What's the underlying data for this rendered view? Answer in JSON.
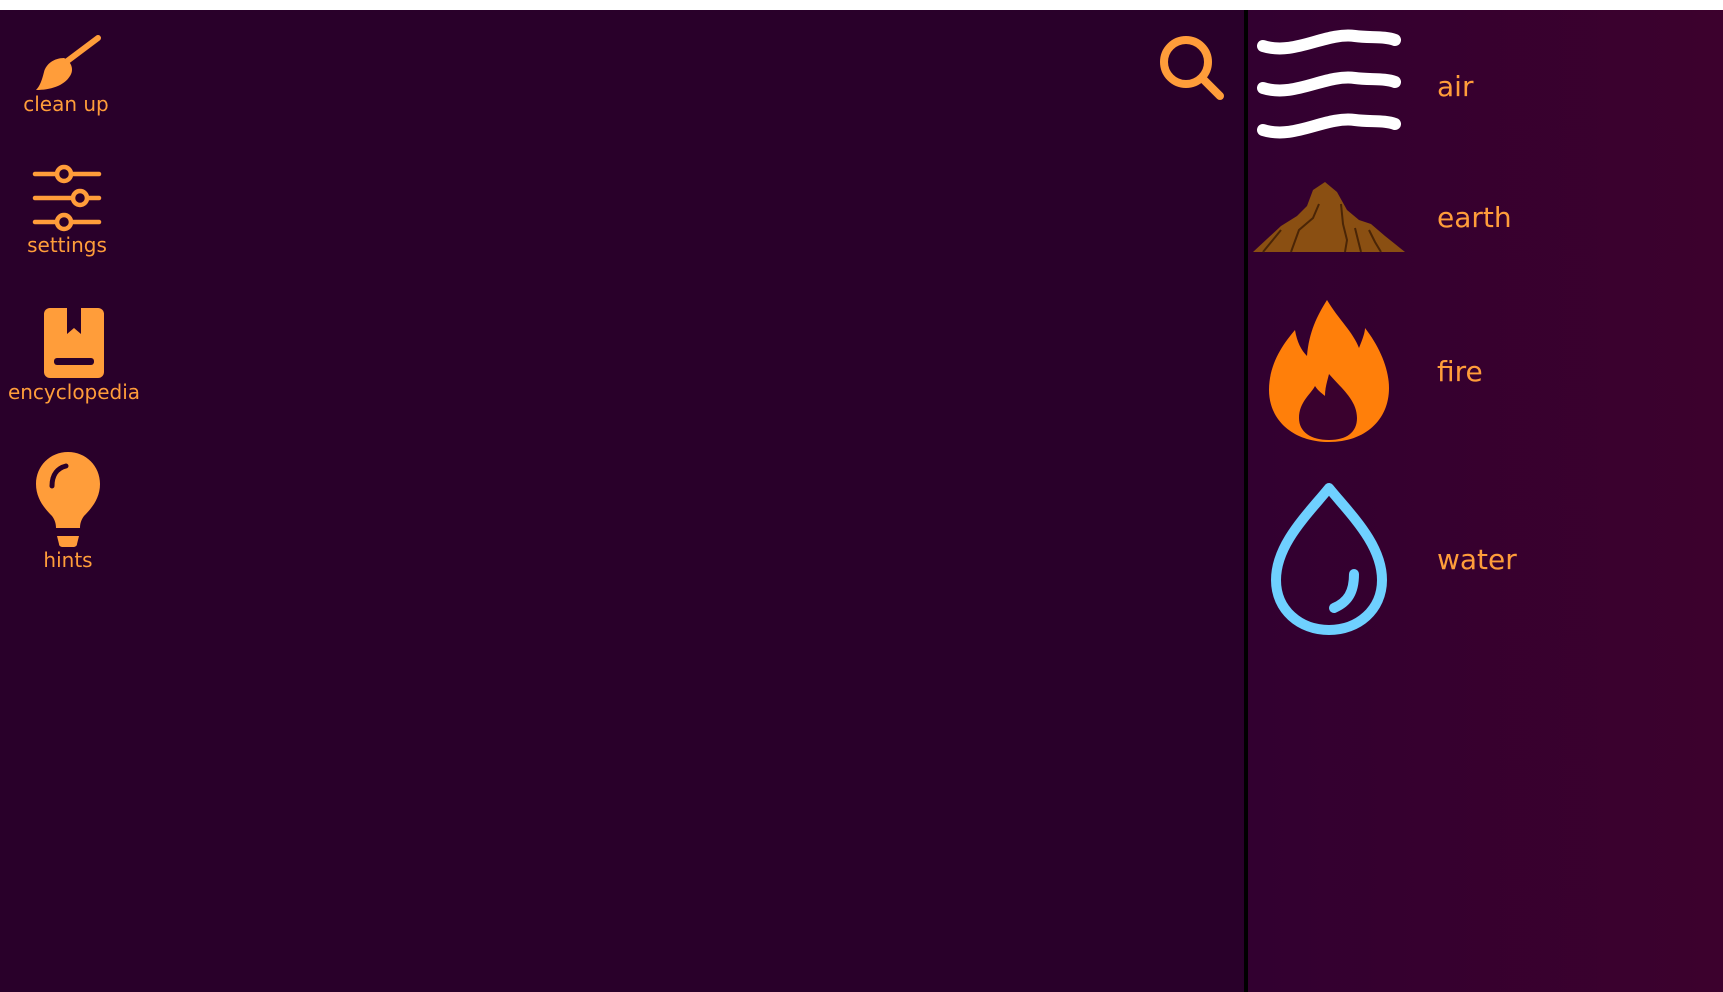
{
  "colors": {
    "accent": "#ff9d3a",
    "workspace_bg": "#29002a",
    "palette_bg": "#3a012e",
    "divider": "#000000"
  },
  "toolbar": {
    "clean_up": {
      "label": "clean up",
      "icon": "broom-icon"
    },
    "settings": {
      "label": "settings",
      "icon": "sliders-icon"
    },
    "encyclopedia": {
      "label": "encyclopedia",
      "icon": "book-icon"
    },
    "hints": {
      "label": "hints",
      "icon": "lightbulb-icon"
    }
  },
  "search": {
    "icon": "search-icon"
  },
  "elements": [
    {
      "name": "air",
      "icon": "air-icon",
      "color": "#ffffff"
    },
    {
      "name": "earth",
      "icon": "mountain-icon",
      "color": "#8a4f12"
    },
    {
      "name": "fire",
      "icon": "flame-icon",
      "color": "#ff7f0a"
    },
    {
      "name": "water",
      "icon": "water-drop-icon",
      "color": "#6fd0ff"
    }
  ]
}
